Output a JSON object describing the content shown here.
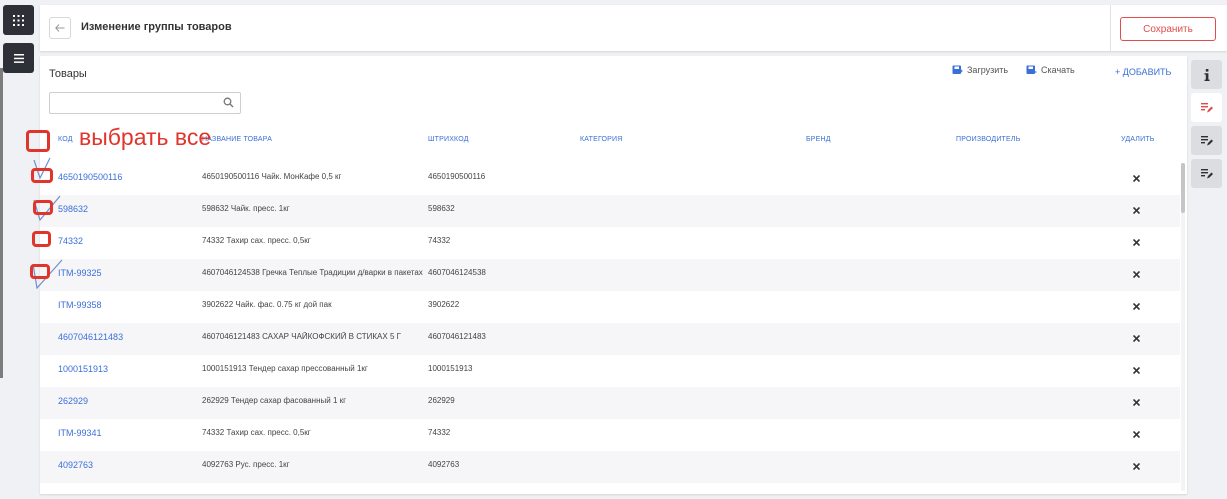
{
  "header": {
    "title": "Изменение группы товаров",
    "save_label": "Сохранить"
  },
  "panel": {
    "title": "Товары",
    "search": {
      "value": "",
      "placeholder": ""
    },
    "upload_label": "Загрузить",
    "download_label": "Скачать",
    "add_label": "+ ДОБАВИТЬ"
  },
  "table": {
    "columns": {
      "code": "КОД",
      "name": "НАЗВАНИЕ ТОВАРА",
      "barcode": "ШТРИХКОД",
      "category": "КАТЕГОРИЯ",
      "brand": "БРЕНД",
      "manufacturer": "ПРОИЗВОДИТЕЛЬ",
      "delete": "УДАЛИТЬ"
    },
    "rows": [
      {
        "code": "4650190500116",
        "name": "4650190500116 Чайк. МонКафе 0,5 кг",
        "barcode": "4650190500116"
      },
      {
        "code": "598632",
        "name": "598632 Чайк. пресс. 1кг",
        "barcode": "598632"
      },
      {
        "code": "74332",
        "name": "74332 Тахир сах. пресс. 0,5кг",
        "barcode": "74332"
      },
      {
        "code": "ITM-99325",
        "name": "4607046124538 Гречка Теплые Традиции д/варки в пакетах",
        "barcode": "4607046124538"
      },
      {
        "code": "ITM-99358",
        "name": "3902622 Чайк. фас. 0.75 кг дой пак",
        "barcode": "3902622"
      },
      {
        "code": "4607046121483",
        "name": "4607046121483 САХАР ЧАЙКОФСКИЙ В СТИКАХ 5 Г",
        "barcode": "4607046121483"
      },
      {
        "code": "1000151913",
        "name": "1000151913 Тендер сахар прессованный 1кг",
        "barcode": "1000151913"
      },
      {
        "code": "262929",
        "name": "262929 Тендер сахар фасованный 1 кг",
        "barcode": "262929"
      },
      {
        "code": "ITM-99341",
        "name": "74332 Тахир сах. пресс. 0,5кг",
        "barcode": "74332"
      },
      {
        "code": "4092763",
        "name": "4092763 Рус. пресс. 1кг",
        "barcode": "4092763"
      }
    ]
  },
  "annotation": {
    "select_all_label": "выбрать все"
  },
  "colors": {
    "accent": "#3a6fd8",
    "save": "#e04d4d",
    "annotation": "#e0352b",
    "dark_rail": "#2d3037"
  },
  "icons": {
    "left_rail": [
      "apps-grid-icon",
      "menu-icon"
    ],
    "right_rail": [
      "info-icon",
      "edit-list-icon",
      "list-edit-icon",
      "list-edit-2-icon"
    ]
  }
}
